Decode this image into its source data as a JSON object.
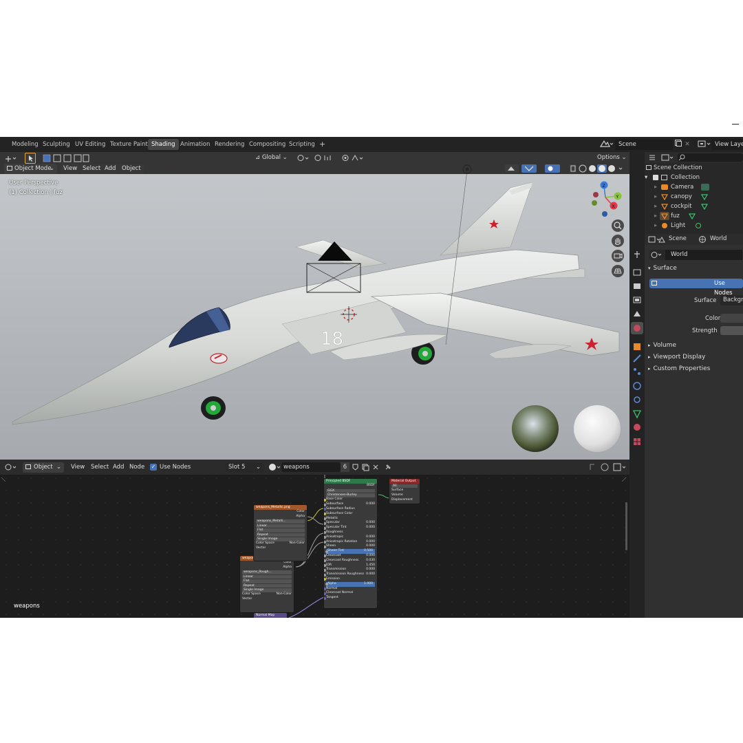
{
  "topbar": {
    "tabs": [
      "Modeling",
      "Sculpting",
      "UV Editing",
      "Texture Paint",
      "Shading",
      "Animation",
      "Rendering",
      "Compositing",
      "Scripting"
    ],
    "active_tab": "Shading",
    "add_tab_glyph": "+",
    "scene_name": "Scene",
    "view_layer_label": "View Layer"
  },
  "viewport": {
    "mode": "Object Mode",
    "menus": [
      "View",
      "Select",
      "Add",
      "Object"
    ],
    "orientation": "Global",
    "options_label": "Options",
    "perspective_label": "User Perspective",
    "collection_label": "(1) Collection | fuz",
    "aircraft_number": "18",
    "gizmo_axes": {
      "x": "X",
      "y": "Y",
      "z": "Z"
    }
  },
  "outliner": {
    "root": "Scene Collection",
    "collection": "Collection",
    "items": [
      {
        "label": "Camera",
        "icon": "camera-icon"
      },
      {
        "label": "canopy",
        "icon": "mesh-icon"
      },
      {
        "label": "cockpit",
        "icon": "mesh-icon"
      },
      {
        "label": "fuz",
        "icon": "mesh-icon"
      },
      {
        "label": "Light",
        "icon": "light-icon"
      }
    ]
  },
  "properties": {
    "breadcrumb_scene": "Scene",
    "breadcrumb_world": "World",
    "world_name": "World",
    "surface_panel": "Surface",
    "use_nodes_button": "Use Nodes",
    "surface_label": "Surface",
    "surface_value": "Backgro",
    "color_label": "Color",
    "strength_label": "Strength",
    "panels": [
      "Volume",
      "Viewport Display",
      "Custom Properties"
    ]
  },
  "node_editor": {
    "object_dropdown": "Object",
    "menus": [
      "View",
      "Select",
      "Add",
      "Node"
    ],
    "use_nodes_label": "Use Nodes",
    "slot": "Slot 5",
    "material_name": "weapons",
    "user_count": "6",
    "footer_material_label": "weapons",
    "principled": {
      "title": "Principled BSDF",
      "output": "BSDF",
      "distribution": "GGX",
      "subsurface_method": "Christensen-Burley",
      "rows": [
        {
          "label": "Base Color",
          "value": ""
        },
        {
          "label": "Subsurface",
          "value": "0.000"
        },
        {
          "label": "Subsurface Radius",
          "value": ""
        },
        {
          "label": "Subsurface Color",
          "value": ""
        },
        {
          "label": "Metallic",
          "value": ""
        },
        {
          "label": "Specular",
          "value": "0.000"
        },
        {
          "label": "Specular Tint",
          "value": "0.000"
        },
        {
          "label": "Roughness",
          "value": ""
        },
        {
          "label": "Anisotropic",
          "value": "0.000"
        },
        {
          "label": "Anisotropic Rotation",
          "value": "0.000"
        },
        {
          "label": "Sheen",
          "value": "0.000"
        },
        {
          "label": "Sheen Tint",
          "value": "0.500"
        },
        {
          "label": "Clearcoat",
          "value": "0.000"
        },
        {
          "label": "Clearcoat Roughness",
          "value": "0.030"
        },
        {
          "label": "IOR",
          "value": "1.450"
        },
        {
          "label": "Transmission",
          "value": "0.000"
        },
        {
          "label": "Transmission Roughness",
          "value": "0.000"
        },
        {
          "label": "Emission",
          "value": ""
        },
        {
          "label": "Alpha",
          "value": "1.000"
        },
        {
          "label": "Normal",
          "value": ""
        },
        {
          "label": "Clearcoat Normal",
          "value": ""
        },
        {
          "label": "Tangent",
          "value": ""
        }
      ]
    },
    "material_output": {
      "title": "Material Output",
      "target": "All",
      "inputs": [
        "Surface",
        "Volume",
        "Displacement"
      ]
    },
    "image_metallic": {
      "title": "weapons_Metallic.png",
      "outputs": [
        "Color",
        "Alpha"
      ],
      "image": "weapons_Metalli...",
      "interpolation": "Linear",
      "projection": "Flat",
      "extension": "Repeat",
      "source": "Single Image",
      "color_space_label": "Color Space",
      "color_space": "Non-Color",
      "input": "Vector"
    },
    "image_roughness": {
      "title": "weapons_Roughness.png",
      "outputs": [
        "Color",
        "Alpha"
      ],
      "image": "weapons_Rough...",
      "interpolation": "Linear",
      "projection": "Flat",
      "extension": "Repeat",
      "source": "Single Image",
      "color_space_label": "Color Space",
      "color_space": "Non-Color",
      "input": "Vector"
    },
    "normal_map": {
      "title": "Normal Map"
    }
  },
  "colors": {
    "accent_blue": "#4772b3",
    "principled_header": "#2f7a4a",
    "output_header": "#8a2a2a",
    "texture_header": "#a2582a",
    "vector_header": "#5b4a8a",
    "gizmo_x": "#e0384a",
    "gizmo_y": "#8ac23a",
    "gizmo_z": "#3a7ad8"
  }
}
